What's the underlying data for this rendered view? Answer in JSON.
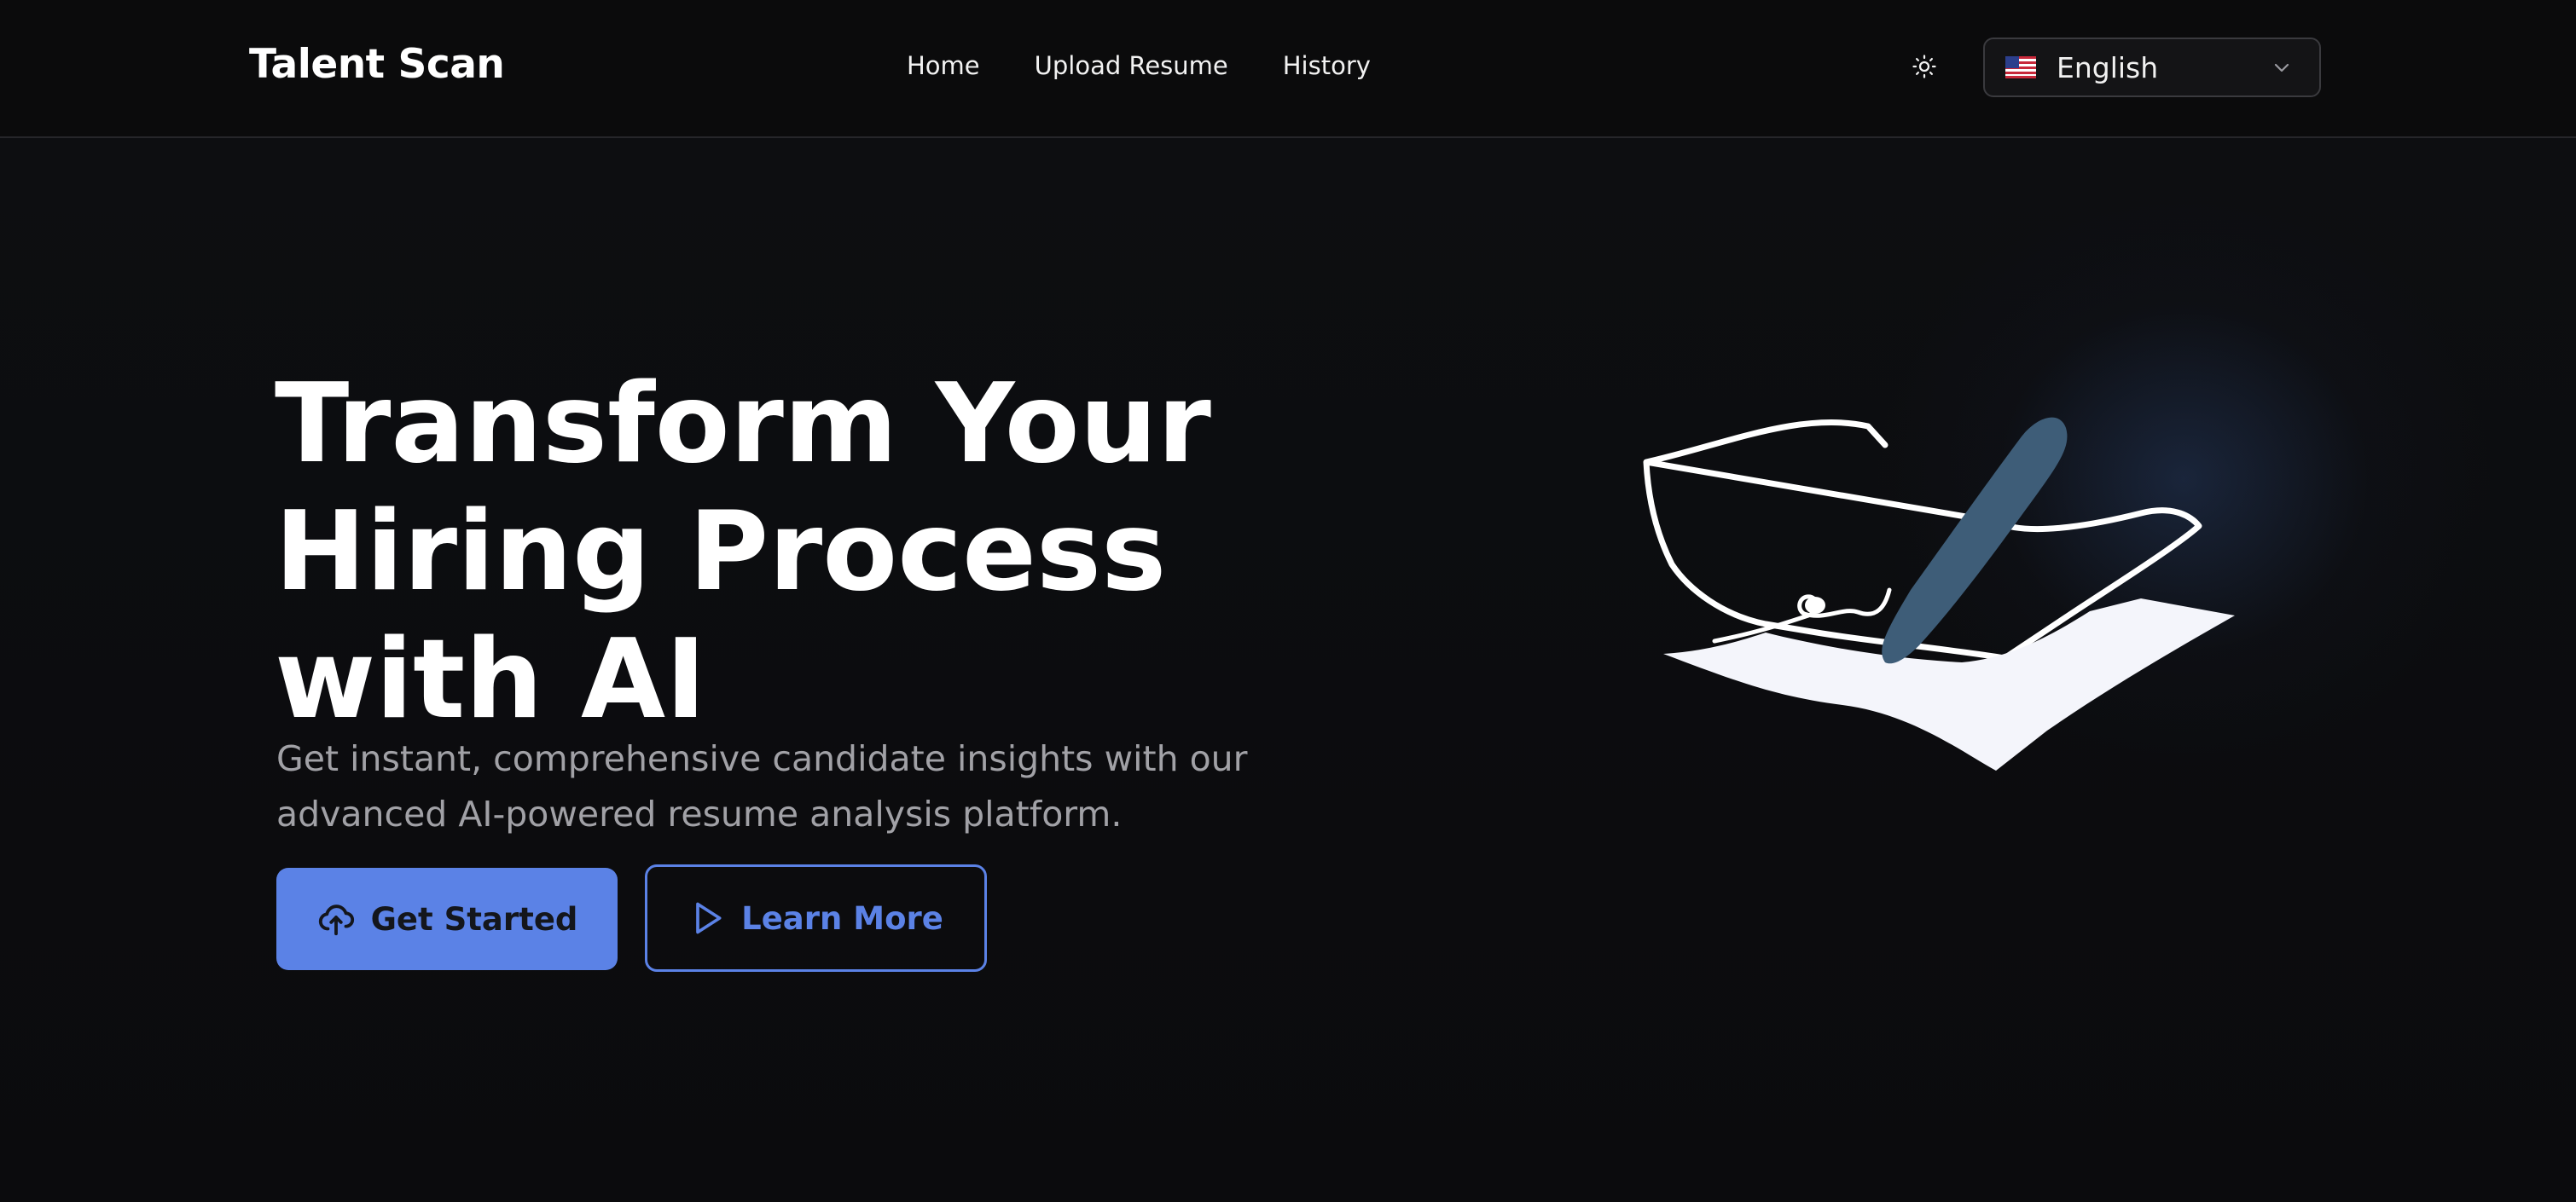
{
  "header": {
    "brand": "Talent Scan",
    "nav": [
      {
        "label": "Home"
      },
      {
        "label": "Upload Resume"
      },
      {
        "label": "History"
      }
    ],
    "theme_toggle_icon": "sun-icon",
    "language": {
      "selected": "English",
      "flag_icon": "us-flag-icon",
      "chevron_icon": "chevron-down-icon"
    }
  },
  "hero": {
    "title": "Transform Your\nHiring Process\nwith AI",
    "subtitle": "Get instant, comprehensive candidate insights with our advanced AI-powered resume analysis platform.",
    "primary_button": {
      "label": "Get Started",
      "icon": "cloud-upload-icon"
    },
    "secondary_button": {
      "label": "Learn More",
      "icon": "play-icon"
    },
    "illustration": "signing-paper-with-pen-illustration"
  },
  "colors": {
    "background": "#0c0c0e",
    "accent": "#5b82e6",
    "text_primary": "#ffffff",
    "text_muted": "#a1a1a6",
    "pen": "#3e5d78"
  }
}
